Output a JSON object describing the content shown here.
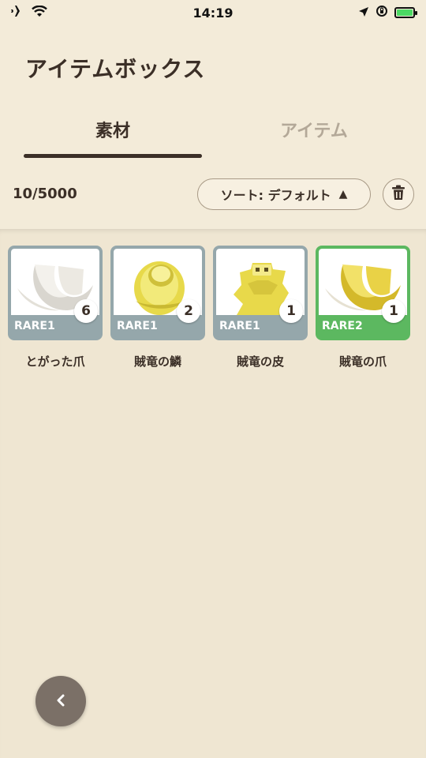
{
  "status": {
    "time": "14:19",
    "icons": [
      "airplane-icon",
      "wifi-icon",
      "location-arrow-icon",
      "rotation-lock-icon",
      "battery-charging-icon"
    ]
  },
  "title": "アイテムボックス",
  "tabs": [
    {
      "label": "素材",
      "active": true
    },
    {
      "label": "アイテム",
      "active": false
    }
  ],
  "count": "10/5000",
  "sort": {
    "label": "ソート:  デフォルト",
    "arrow": "▲"
  },
  "items": [
    {
      "name": "とがった爪",
      "rarity": "RARE1",
      "qty": "6",
      "art": "claw-white"
    },
    {
      "name": "賊竜の鱗",
      "rarity": "RARE1",
      "qty": "2",
      "art": "scale-yellow"
    },
    {
      "name": "賊竜の皮",
      "rarity": "RARE1",
      "qty": "1",
      "art": "hide-yellow"
    },
    {
      "name": "賊竜の爪",
      "rarity": "RARE2",
      "qty": "1",
      "art": "claw-yellow"
    }
  ],
  "colors": {
    "background": "#f3ebd9",
    "rare1": "#95a7ab",
    "rare2": "#5cb860",
    "text": "#3b2f27",
    "inactive_tab": "#b3a898"
  },
  "back_icon": "chevron-left-icon"
}
